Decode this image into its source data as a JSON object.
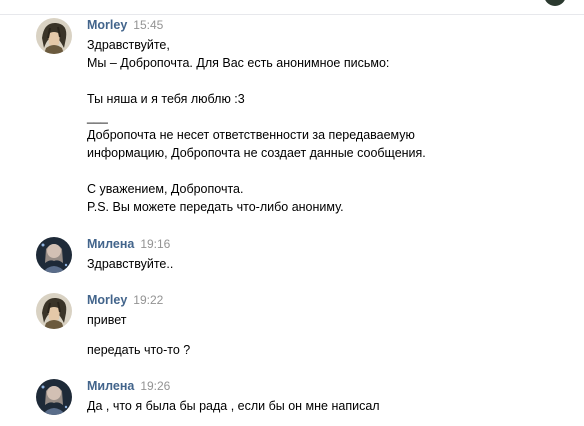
{
  "messages": [
    {
      "author": "Morley",
      "time": "15:45",
      "lines": [
        "Здравствуйте,",
        "Мы – Добропочта. Для Вас есть анонимное письмо:",
        "",
        "Ты няша и я тебя люблю :3",
        "___",
        "Добропочта не несет ответственности за передаваемую",
        "информацию, Добропочта не создает данные сообщения.",
        "",
        "С уважением, Добропочта.",
        "P.S. Вы можете передать что-либо анониму."
      ]
    },
    {
      "author": "Милена",
      "time": "19:16",
      "lines": [
        "Здравствуйте.."
      ]
    },
    {
      "author": "Morley",
      "time": "19:22",
      "lines": [
        "привет",
        "передать что-то ?"
      ]
    },
    {
      "author": "Милена",
      "time": "19:26",
      "lines": [
        "Да , что я была бы рада , если бы он мне написал"
      ]
    }
  ],
  "colors": {
    "author": "#42648b",
    "time": "#939393",
    "text": "#000000"
  }
}
